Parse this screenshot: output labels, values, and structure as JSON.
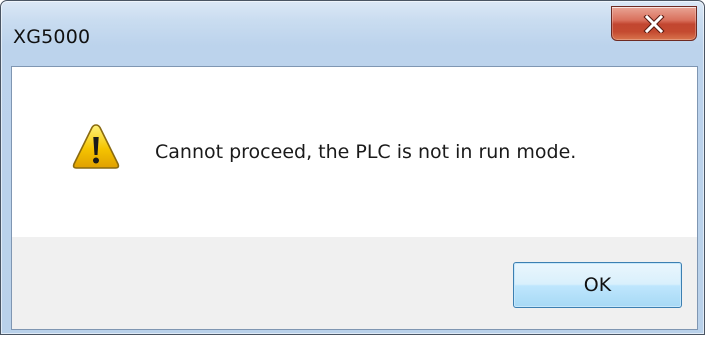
{
  "window": {
    "title": "XG5000",
    "close_icon": "close-icon"
  },
  "dialog": {
    "icon": "warning-icon",
    "message": "Cannot proceed, the PLC is not in run mode.",
    "ok_label": "OK"
  },
  "colors": {
    "frame": "#bcd3ec",
    "close_button": "#c44a30",
    "button_border": "#3c7fb1",
    "warning_fill": "#f5c400"
  }
}
